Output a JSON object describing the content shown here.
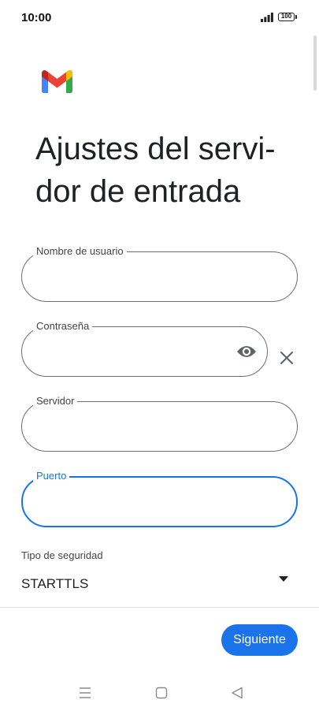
{
  "status_bar": {
    "time": "10:00",
    "battery": "100",
    "icons": [
      "signal-icon",
      "battery-icon"
    ]
  },
  "app": {
    "logo": "gmail-logo",
    "colors": {
      "accent": "#1a73e8",
      "text": "#202124",
      "border": "#6f6f6f",
      "label": "#444444"
    }
  },
  "page": {
    "title": "Ajustes del servi-dor de entrada",
    "title_line1": "Ajustes del servi-",
    "title_line2": "dor de entrada"
  },
  "form": {
    "username": {
      "label": "Nombre de usuario",
      "value": ""
    },
    "password": {
      "label": "Contraseña",
      "value": "",
      "icons": [
        "eye-icon",
        "close-icon"
      ]
    },
    "server": {
      "label": "Servidor",
      "value": ""
    },
    "port": {
      "label": "Puerto",
      "value": "",
      "focused": true
    },
    "security": {
      "label": "Tipo de seguridad",
      "value": "STARTTLS",
      "icon": "dropdown-arrow-icon"
    }
  },
  "footer": {
    "next_label": "Siguiente"
  },
  "nav_bar": {
    "icons": [
      "menu-icon",
      "home-icon",
      "back-icon"
    ]
  }
}
